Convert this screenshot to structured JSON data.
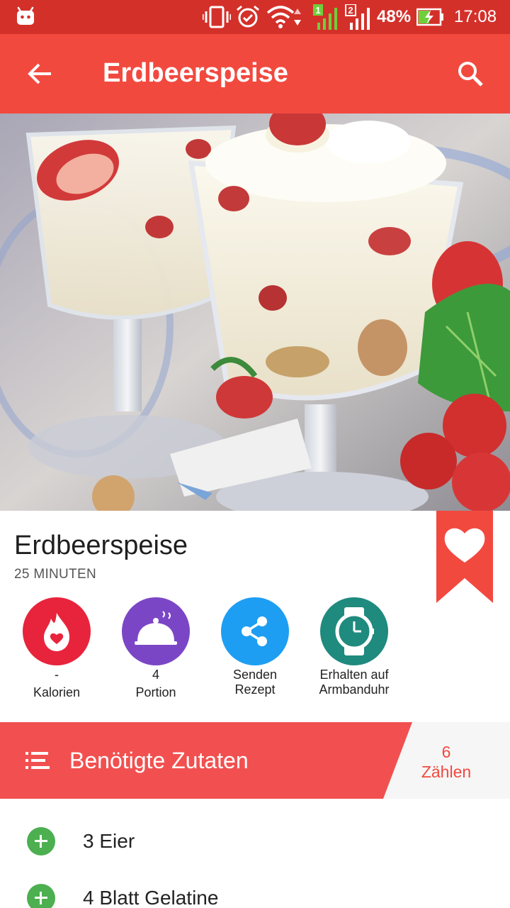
{
  "status_bar": {
    "battery": "48%",
    "time": "17:08",
    "icons": [
      "android-icon",
      "vibrate-icon",
      "alarm-icon",
      "wifi-icon",
      "sim1-signal-icon",
      "sim2-signal-icon",
      "battery-charging-icon"
    ],
    "sim1_label": "1",
    "sim2_label": "2"
  },
  "app_bar": {
    "title": "Erdbeerspeise",
    "back_icon": "arrow-back-icon",
    "search_icon": "search-icon",
    "color": "#f2493f"
  },
  "recipe": {
    "title": "Erdbeerspeise",
    "duration": "25 MINUTEN",
    "favorite_icon": "heart-bookmark-icon"
  },
  "actions": [
    {
      "icon": "flame-icon",
      "line1": "-",
      "line2": "Kalorien",
      "color": "#e8243c"
    },
    {
      "icon": "serving-dish-icon",
      "line1": "4",
      "line2": "Portion",
      "color": "#7b46c6"
    },
    {
      "icon": "share-icon",
      "line1": "Senden",
      "line2": "Rezept",
      "color": "#1e9ef2"
    },
    {
      "icon": "watch-icon",
      "line1": "Erhalten auf",
      "line2": "Armbanduhr",
      "color": "#1f8a7e"
    }
  ],
  "ingredients": {
    "header": "Benötigte Zutaten",
    "count": "6",
    "count_label": "Zählen",
    "items": [
      "3 Eier",
      "4 Blatt Gelatine"
    ]
  },
  "colors": {
    "status_bar": "#d4302a",
    "accent": "#f2493f",
    "add_button": "#4caf50"
  }
}
